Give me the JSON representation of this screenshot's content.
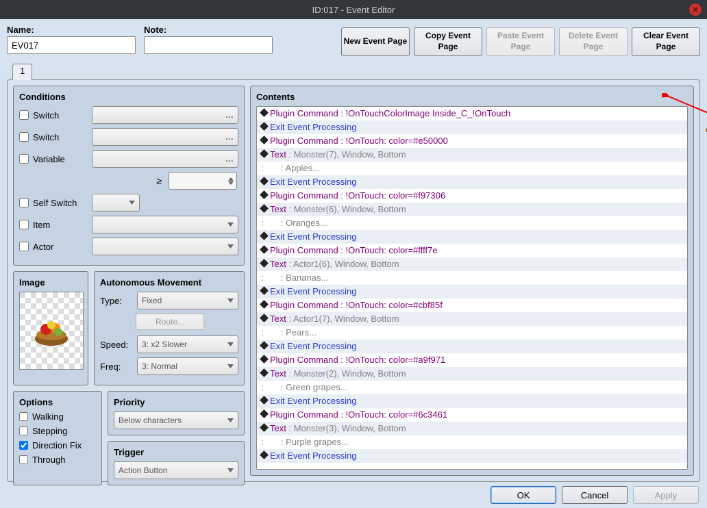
{
  "window": {
    "title": "ID:017 - Event Editor"
  },
  "top": {
    "name_label": "Name:",
    "name_value": "EV017",
    "note_label": "Note:",
    "note_value": "",
    "buttons": {
      "new": "New\nEvent Page",
      "copy": "Copy\nEvent Page",
      "paste": "Paste\nEvent Page",
      "delete": "Delete\nEvent Page",
      "clear": "Clear\nEvent Page"
    }
  },
  "tab": {
    "label": "1"
  },
  "conditions": {
    "title": "Conditions",
    "switch1": "Switch",
    "switch2": "Switch",
    "variable": "Variable",
    "ge": "≥",
    "self_switch": "Self Switch",
    "item": "Item",
    "actor": "Actor"
  },
  "image": {
    "title": "Image"
  },
  "autonomous": {
    "title": "Autonomous Movement",
    "type_label": "Type:",
    "type_value": "Fixed",
    "route_label": "Route...",
    "speed_label": "Speed:",
    "speed_value": "3: x2 Slower",
    "freq_label": "Freq:",
    "freq_value": "3: Normal"
  },
  "options": {
    "title": "Options",
    "walking": "Walking",
    "stepping": "Stepping",
    "direction_fix": "Direction Fix",
    "through": "Through"
  },
  "priority": {
    "title": "Priority",
    "value": "Below characters"
  },
  "trigger": {
    "title": "Trigger",
    "value": "Action Button"
  },
  "contents": {
    "title": "Contents",
    "lines": [
      {
        "cmd": "Plugin Command",
        "arg": "!OnTouchColorImage Inside_C_!OnTouch",
        "cls": "t-purple"
      },
      {
        "cmd": "Exit Event Processing",
        "arg": "",
        "cls": "t-blue"
      },
      {
        "cmd": "Plugin Command",
        "arg": "!OnTouch: color=#e50000",
        "cls": "t-purple"
      },
      {
        "cmd": "Text",
        "arg": "Monster(7), Window, Bottom",
        "cls": "t-grey"
      },
      {
        "cmd": ":",
        "arg": "    : Apples...",
        "cls": "t-grey"
      },
      {
        "cmd": "Exit Event Processing",
        "arg": "",
        "cls": "t-blue"
      },
      {
        "cmd": "Plugin Command",
        "arg": "!OnTouch: color=#f97306",
        "cls": "t-purple"
      },
      {
        "cmd": "Text",
        "arg": "Monster(6), Window, Bottom",
        "cls": "t-grey"
      },
      {
        "cmd": ":",
        "arg": "    : Oranges...",
        "cls": "t-grey"
      },
      {
        "cmd": "Exit Event Processing",
        "arg": "",
        "cls": "t-blue"
      },
      {
        "cmd": "Plugin Command",
        "arg": "!OnTouch: color=#ffff7e",
        "cls": "t-purple"
      },
      {
        "cmd": "Text",
        "arg": "Actor1(6), Window, Bottom",
        "cls": "t-grey"
      },
      {
        "cmd": ":",
        "arg": "    : Bananas...",
        "cls": "t-grey"
      },
      {
        "cmd": "Exit Event Processing",
        "arg": "",
        "cls": "t-blue"
      },
      {
        "cmd": "Plugin Command",
        "arg": "!OnTouch: color=#cbf85f",
        "cls": "t-purple"
      },
      {
        "cmd": "Text",
        "arg": "Actor1(7), Window, Bottom",
        "cls": "t-grey"
      },
      {
        "cmd": ":",
        "arg": "    : Pears...",
        "cls": "t-grey"
      },
      {
        "cmd": "Exit Event Processing",
        "arg": "",
        "cls": "t-blue"
      },
      {
        "cmd": "Plugin Command",
        "arg": "!OnTouch: color=#a9f971",
        "cls": "t-purple"
      },
      {
        "cmd": "Text",
        "arg": "Monster(2), Window, Bottom",
        "cls": "t-grey"
      },
      {
        "cmd": ":",
        "arg": "    : Green grapes...",
        "cls": "t-grey"
      },
      {
        "cmd": "Exit Event Processing",
        "arg": "",
        "cls": "t-blue"
      },
      {
        "cmd": "Plugin Command",
        "arg": "!OnTouch: color=#6c3461",
        "cls": "t-purple"
      },
      {
        "cmd": "Text",
        "arg": "Monster(3), Window, Bottom",
        "cls": "t-grey"
      },
      {
        "cmd": ":",
        "arg": "    : Purple grapes...",
        "cls": "t-grey"
      },
      {
        "cmd": "Exit Event Processing",
        "arg": "",
        "cls": "t-blue"
      }
    ]
  },
  "bottom": {
    "ok": "OK",
    "cancel": "Cancel",
    "apply": "Apply"
  }
}
